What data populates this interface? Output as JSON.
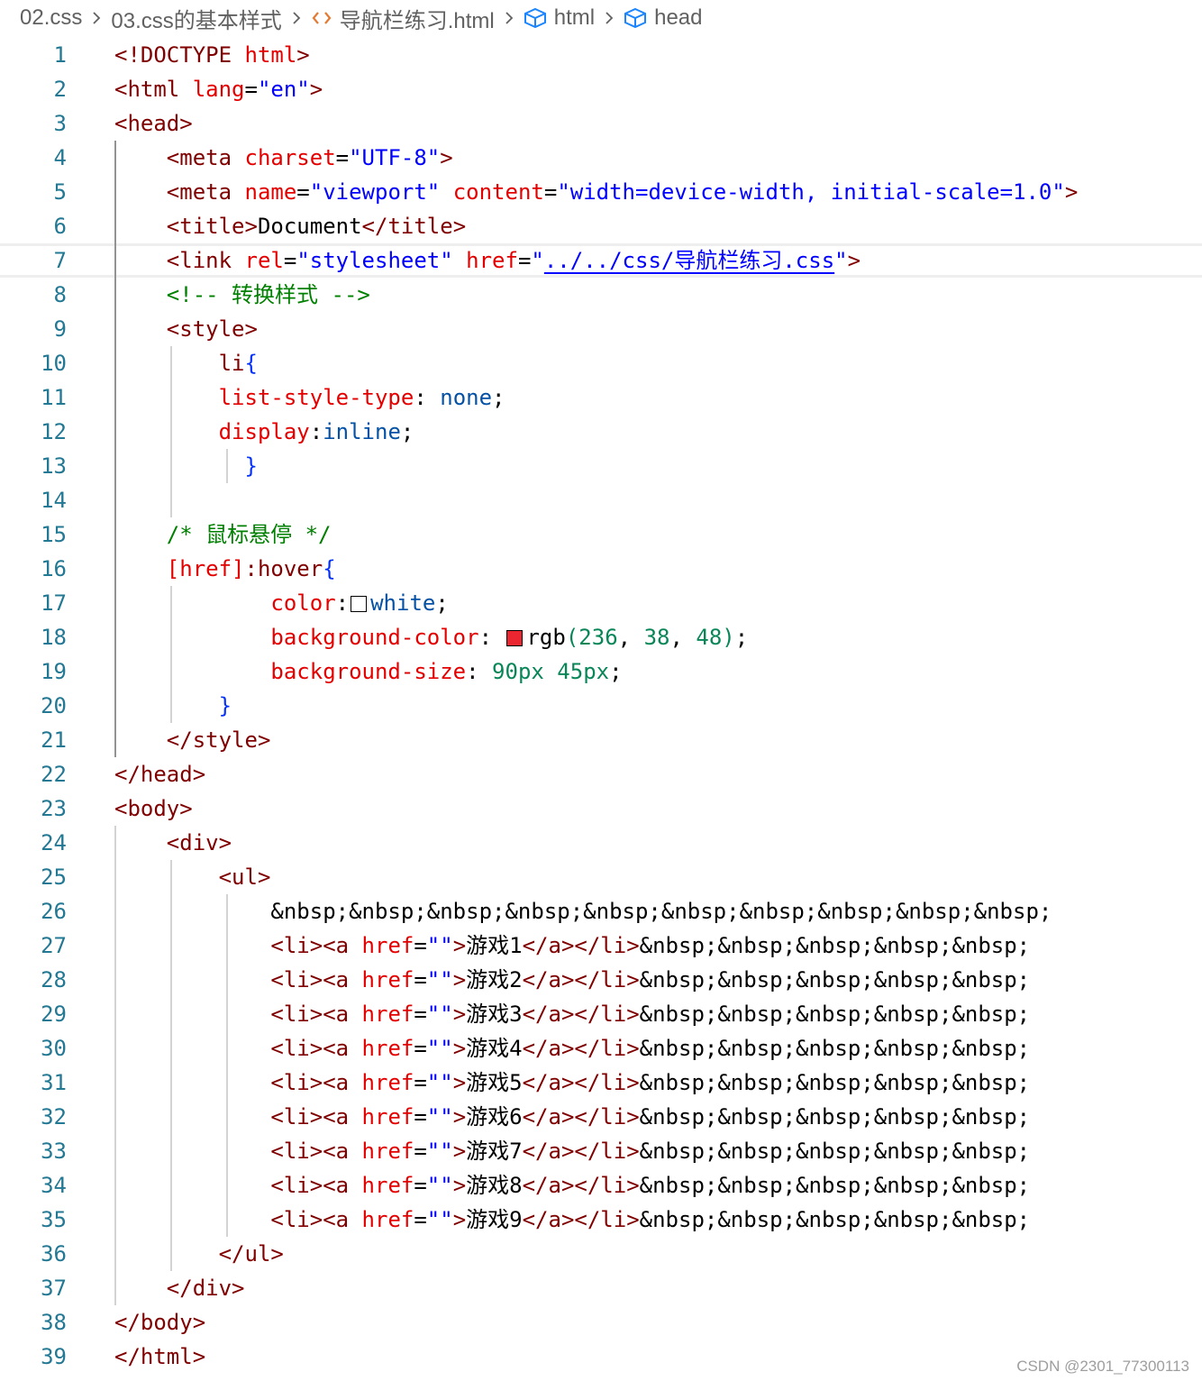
{
  "breadcrumb": {
    "items": [
      {
        "label": "02.css",
        "icon": null
      },
      {
        "label": "03.css的基本样式",
        "icon": null
      },
      {
        "label": "导航栏练习.html",
        "icon": "html-file-icon"
      },
      {
        "label": "html",
        "icon": "element-box-icon"
      },
      {
        "label": "head",
        "icon": "element-box-icon"
      }
    ]
  },
  "colors": {
    "tag": "#800000",
    "attribute": "#e50000",
    "string": "#0000ff",
    "comment": "#008000",
    "css_value": "#0451a5",
    "number": "#098658",
    "line_number": "#237893",
    "swatch_white": "#ffffff",
    "swatch_red": "#ec2630"
  },
  "editor": {
    "current_line": 7,
    "lines": [
      [
        [
          "tag",
          "<!DOCTYPE"
        ],
        [
          "text",
          " "
        ],
        [
          "attr",
          "html"
        ],
        [
          "tag",
          ">"
        ]
      ],
      [
        [
          "tag",
          "<html"
        ],
        [
          "text",
          " "
        ],
        [
          "attr",
          "lang"
        ],
        [
          "text",
          "="
        ],
        [
          "str",
          "\"en\""
        ],
        [
          "tag",
          ">"
        ]
      ],
      [
        [
          "tag",
          "<head>"
        ]
      ],
      [
        [
          "text",
          "    "
        ],
        [
          "tag",
          "<meta"
        ],
        [
          "text",
          " "
        ],
        [
          "attr",
          "charset"
        ],
        [
          "text",
          "="
        ],
        [
          "str",
          "\"UTF-8\""
        ],
        [
          "tag",
          ">"
        ]
      ],
      [
        [
          "text",
          "    "
        ],
        [
          "tag",
          "<meta"
        ],
        [
          "text",
          " "
        ],
        [
          "attr",
          "name"
        ],
        [
          "text",
          "="
        ],
        [
          "str",
          "\"viewport\""
        ],
        [
          "text",
          " "
        ],
        [
          "attr",
          "content"
        ],
        [
          "text",
          "="
        ],
        [
          "str",
          "\"width=device-width, initial-scale=1.0\""
        ],
        [
          "tag",
          ">"
        ]
      ],
      [
        [
          "text",
          "    "
        ],
        [
          "tag",
          "<title>"
        ],
        [
          "text",
          "Document"
        ],
        [
          "tag",
          "</title>"
        ]
      ],
      [
        [
          "text",
          "    "
        ],
        [
          "tag",
          "<link"
        ],
        [
          "text",
          " "
        ],
        [
          "attr",
          "rel"
        ],
        [
          "text",
          "="
        ],
        [
          "str",
          "\"stylesheet\""
        ],
        [
          "text",
          " "
        ],
        [
          "attr",
          "href"
        ],
        [
          "text",
          "="
        ],
        [
          "str",
          "\""
        ],
        [
          "link",
          "../../css/导航栏练习.css"
        ],
        [
          "str",
          "\""
        ],
        [
          "tag",
          ">"
        ]
      ],
      [
        [
          "text",
          "    "
        ],
        [
          "com",
          "<!-- 转换样式 -->"
        ]
      ],
      [
        [
          "text",
          "    "
        ],
        [
          "tag",
          "<style>"
        ]
      ],
      [
        [
          "text",
          "        "
        ],
        [
          "tag",
          "li"
        ],
        [
          "br",
          "{"
        ]
      ],
      [
        [
          "text",
          "        "
        ],
        [
          "prop",
          "list-style-type"
        ],
        [
          "text",
          ": "
        ],
        [
          "val",
          "none"
        ],
        [
          "text",
          ";"
        ]
      ],
      [
        [
          "text",
          "        "
        ],
        [
          "prop",
          "display"
        ],
        [
          "text",
          ":"
        ],
        [
          "val",
          "inline"
        ],
        [
          "text",
          ";"
        ]
      ],
      [
        [
          "text",
          "          "
        ],
        [
          "br",
          "}"
        ]
      ],
      [],
      [
        [
          "text",
          "    "
        ],
        [
          "com",
          "/* 鼠标悬停 */"
        ]
      ],
      [
        [
          "text",
          "    "
        ],
        [
          "attr",
          "[href]"
        ],
        [
          "tag",
          ":hover"
        ],
        [
          "br",
          "{"
        ]
      ],
      [
        [
          "text",
          "            "
        ],
        [
          "prop",
          "color"
        ],
        [
          "text",
          ":"
        ],
        [
          "swatch",
          "swatch_white"
        ],
        [
          "val",
          "white"
        ],
        [
          "text",
          ";"
        ]
      ],
      [
        [
          "text",
          "            "
        ],
        [
          "prop",
          "background-color"
        ],
        [
          "text",
          ": "
        ],
        [
          "swatch",
          "swatch_red"
        ],
        [
          "text",
          "rgb"
        ],
        [
          "num",
          "("
        ],
        [
          "num",
          "236"
        ],
        [
          "text",
          ", "
        ],
        [
          "num",
          "38"
        ],
        [
          "text",
          ", "
        ],
        [
          "num",
          "48"
        ],
        [
          "num",
          ")"
        ],
        [
          "text",
          ";"
        ]
      ],
      [
        [
          "text",
          "            "
        ],
        [
          "prop",
          "background-size"
        ],
        [
          "text",
          ": "
        ],
        [
          "num",
          "90px"
        ],
        [
          "text",
          " "
        ],
        [
          "num",
          "45px"
        ],
        [
          "text",
          ";"
        ]
      ],
      [
        [
          "text",
          "        "
        ],
        [
          "br",
          "}"
        ]
      ],
      [
        [
          "text",
          "    "
        ],
        [
          "tag",
          "</style>"
        ]
      ],
      [
        [
          "tag",
          "</head>"
        ]
      ],
      [
        [
          "tag",
          "<body>"
        ]
      ],
      [
        [
          "text",
          "    "
        ],
        [
          "tag",
          "<div>"
        ]
      ],
      [
        [
          "text",
          "        "
        ],
        [
          "tag",
          "<ul>"
        ]
      ],
      [
        [
          "text",
          "            &nbsp;&nbsp;&nbsp;&nbsp;&nbsp;&nbsp;&nbsp;&nbsp;&nbsp;&nbsp;"
        ]
      ],
      [
        [
          "text",
          "            "
        ],
        [
          "tag",
          "<li><a"
        ],
        [
          "text",
          " "
        ],
        [
          "attr",
          "href"
        ],
        [
          "text",
          "="
        ],
        [
          "str",
          "\"\""
        ],
        [
          "tag",
          ">"
        ],
        [
          "text",
          "游戏1"
        ],
        [
          "tag",
          "</a></li>"
        ],
        [
          "text",
          "&nbsp;&nbsp;&nbsp;&nbsp;&nbsp;"
        ]
      ],
      [
        [
          "text",
          "            "
        ],
        [
          "tag",
          "<li><a"
        ],
        [
          "text",
          " "
        ],
        [
          "attr",
          "href"
        ],
        [
          "text",
          "="
        ],
        [
          "str",
          "\"\""
        ],
        [
          "tag",
          ">"
        ],
        [
          "text",
          "游戏2"
        ],
        [
          "tag",
          "</a></li>"
        ],
        [
          "text",
          "&nbsp;&nbsp;&nbsp;&nbsp;&nbsp;"
        ]
      ],
      [
        [
          "text",
          "            "
        ],
        [
          "tag",
          "<li><a"
        ],
        [
          "text",
          " "
        ],
        [
          "attr",
          "href"
        ],
        [
          "text",
          "="
        ],
        [
          "str",
          "\"\""
        ],
        [
          "tag",
          ">"
        ],
        [
          "text",
          "游戏3"
        ],
        [
          "tag",
          "</a></li>"
        ],
        [
          "text",
          "&nbsp;&nbsp;&nbsp;&nbsp;&nbsp;"
        ]
      ],
      [
        [
          "text",
          "            "
        ],
        [
          "tag",
          "<li><a"
        ],
        [
          "text",
          " "
        ],
        [
          "attr",
          "href"
        ],
        [
          "text",
          "="
        ],
        [
          "str",
          "\"\""
        ],
        [
          "tag",
          ">"
        ],
        [
          "text",
          "游戏4"
        ],
        [
          "tag",
          "</a></li>"
        ],
        [
          "text",
          "&nbsp;&nbsp;&nbsp;&nbsp;&nbsp;"
        ]
      ],
      [
        [
          "text",
          "            "
        ],
        [
          "tag",
          "<li><a"
        ],
        [
          "text",
          " "
        ],
        [
          "attr",
          "href"
        ],
        [
          "text",
          "="
        ],
        [
          "str",
          "\"\""
        ],
        [
          "tag",
          ">"
        ],
        [
          "text",
          "游戏5"
        ],
        [
          "tag",
          "</a></li>"
        ],
        [
          "text",
          "&nbsp;&nbsp;&nbsp;&nbsp;&nbsp;"
        ]
      ],
      [
        [
          "text",
          "            "
        ],
        [
          "tag",
          "<li><a"
        ],
        [
          "text",
          " "
        ],
        [
          "attr",
          "href"
        ],
        [
          "text",
          "="
        ],
        [
          "str",
          "\"\""
        ],
        [
          "tag",
          ">"
        ],
        [
          "text",
          "游戏6"
        ],
        [
          "tag",
          "</a></li>"
        ],
        [
          "text",
          "&nbsp;&nbsp;&nbsp;&nbsp;&nbsp;"
        ]
      ],
      [
        [
          "text",
          "            "
        ],
        [
          "tag",
          "<li><a"
        ],
        [
          "text",
          " "
        ],
        [
          "attr",
          "href"
        ],
        [
          "text",
          "="
        ],
        [
          "str",
          "\"\""
        ],
        [
          "tag",
          ">"
        ],
        [
          "text",
          "游戏7"
        ],
        [
          "tag",
          "</a></li>"
        ],
        [
          "text",
          "&nbsp;&nbsp;&nbsp;&nbsp;&nbsp;"
        ]
      ],
      [
        [
          "text",
          "            "
        ],
        [
          "tag",
          "<li><a"
        ],
        [
          "text",
          " "
        ],
        [
          "attr",
          "href"
        ],
        [
          "text",
          "="
        ],
        [
          "str",
          "\"\""
        ],
        [
          "tag",
          ">"
        ],
        [
          "text",
          "游戏8"
        ],
        [
          "tag",
          "</a></li>"
        ],
        [
          "text",
          "&nbsp;&nbsp;&nbsp;&nbsp;&nbsp;"
        ]
      ],
      [
        [
          "text",
          "            "
        ],
        [
          "tag",
          "<li><a"
        ],
        [
          "text",
          " "
        ],
        [
          "attr",
          "href"
        ],
        [
          "text",
          "="
        ],
        [
          "str",
          "\"\""
        ],
        [
          "tag",
          ">"
        ],
        [
          "text",
          "游戏9"
        ],
        [
          "tag",
          "</a></li>"
        ],
        [
          "text",
          "&nbsp;&nbsp;&nbsp;&nbsp;&nbsp;"
        ]
      ],
      [
        [
          "text",
          "        "
        ],
        [
          "tag",
          "</ul>"
        ]
      ],
      [
        [
          "text",
          "    "
        ],
        [
          "tag",
          "</div>"
        ]
      ],
      [
        [
          "tag",
          "</body>"
        ]
      ],
      [
        [
          "tag",
          "</html>"
        ]
      ]
    ]
  },
  "watermark": "CSDN @2301_77300113"
}
